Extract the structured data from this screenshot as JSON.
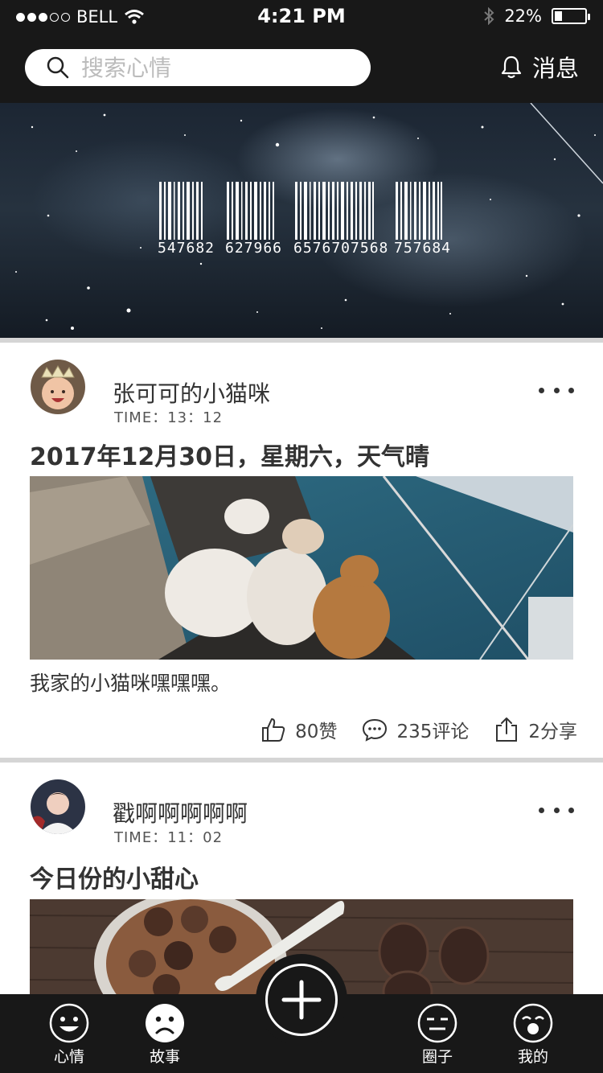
{
  "status_bar": {
    "carrier": "BELL",
    "time": "4:21 PM",
    "battery": "22%",
    "battery_level": 0.22,
    "icons": [
      "signal-dots",
      "wifi-icon",
      "bluetooth-icon",
      "battery-icon"
    ]
  },
  "header": {
    "search_placeholder": "搜索心情",
    "search_value": "",
    "messages_label": "消息"
  },
  "banner": {
    "barcode_numbers": [
      "547682",
      "627966",
      "6576707568",
      "757684"
    ]
  },
  "posts": [
    {
      "username": "张可可的小猫咪",
      "time": "TIME：13：12",
      "title": "2017年12月30日，星期六，天气晴",
      "caption": "我家的小猫咪嘿嘿嘿。",
      "likes": "80赞",
      "comments": "235评论",
      "shares": "2分享"
    },
    {
      "username": "戳啊啊啊啊啊",
      "time": "TIME：11：02",
      "title": "今日份的小甜心"
    }
  ],
  "tabbar": {
    "tabs": [
      {
        "label": "心情",
        "icon": "smile-face-icon"
      },
      {
        "label": "故事",
        "icon": "sad-face-icon",
        "active": true
      },
      {
        "label": "圈子",
        "icon": "neutral-face-icon"
      },
      {
        "label": "我的",
        "icon": "surprised-face-icon"
      }
    ],
    "add_icon": "plus-icon"
  },
  "colors": {
    "dark": "#181818",
    "background": "#e6e6e6",
    "text": "#333333"
  }
}
